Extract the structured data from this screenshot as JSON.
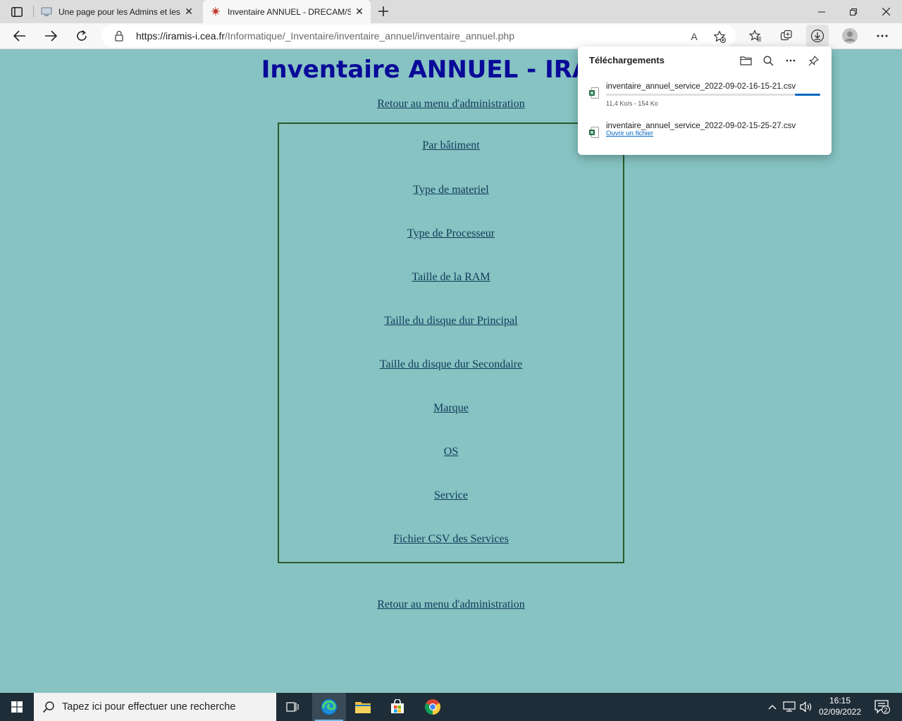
{
  "browser": {
    "tabs": [
      {
        "title": "Une page pour les Admins et les",
        "active": false
      },
      {
        "title": "Inventaire ANNUEL - DRECAM/S",
        "active": true
      }
    ],
    "url_host": "https://iramis-i.cea.fr",
    "url_path": "/Informatique/_Inventaire/inventaire_annuel/inventaire_annuel.php",
    "read_aloud_label": "A"
  },
  "page": {
    "title": "Inventaire ANNUEL - IRAMIS",
    "back_link": "Retour au menu d'administration",
    "menu": [
      "Par bâtiment",
      "Type de materiel",
      "Type de Processeur",
      "Taille de la RAM",
      "Taille du disque dur Principal",
      "Taille du disque dur Secondaire",
      "Marque",
      "OS",
      "Service",
      "Fichier CSV des Services"
    ]
  },
  "downloads": {
    "title": "Téléchargements",
    "items": [
      {
        "filename": "inventaire_annuel_service_2022-09-02-16-15-21.csv",
        "status": "11,4 Ko/s - 154 Ko",
        "in_progress": true,
        "progress_fraction": 0.12
      },
      {
        "filename": "inventaire_annuel_service_2022-09-02-15-25-27.csv",
        "open_label": "Ouvrir un fichier",
        "in_progress": false
      }
    ]
  },
  "taskbar": {
    "search_placeholder": "Tapez ici pour effectuer une recherche",
    "time": "16:15",
    "date": "02/09/2022",
    "notification_count": "2"
  },
  "colors": {
    "page_background": "#86c3c2",
    "title": "#0a0a99",
    "link": "#123a5a",
    "box_border": "#2a5a2a",
    "accent": "#0067c0"
  }
}
